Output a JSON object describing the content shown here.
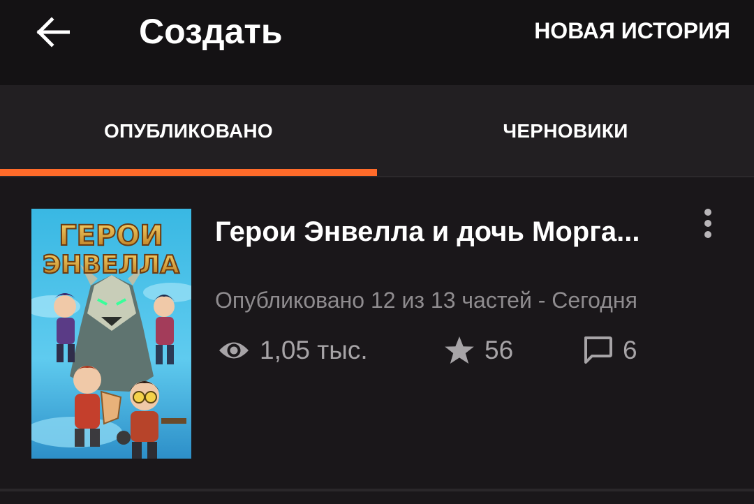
{
  "appbar": {
    "title": "Создать",
    "action_label": "НОВАЯ ИСТОРИЯ",
    "back_icon": "arrow-left-icon"
  },
  "tabs": [
    {
      "label": "ОПУБЛИКОВАНО",
      "selected": true
    },
    {
      "label": "ЧЕРНОВИКИ",
      "selected": false
    }
  ],
  "colors": {
    "accent": "#ff6b2a",
    "background": "#1a171a",
    "appbar": "#141214",
    "tabs_bg": "#221f22",
    "meta_text": "#8f8c8f"
  },
  "story": {
    "title": "Герои Энвелла и дочь Морга...",
    "status": "Опубликовано 12 из 13 частей - Сегодня",
    "cover_title_line1": "ГЕРОИ",
    "cover_title_line2": "ЭНВЕЛЛА",
    "views": "1,05 тыс.",
    "votes": "56",
    "comments": "6",
    "icons": {
      "views": "eye-icon",
      "votes": "star-icon",
      "comments": "comment-icon",
      "more": "more-vertical-icon"
    }
  }
}
